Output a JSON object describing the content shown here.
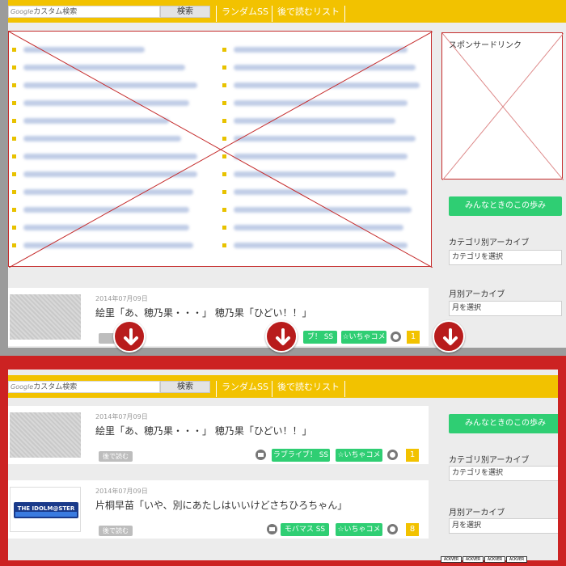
{
  "header": {
    "search_logo": "Google",
    "search_placeholder": "カスタム検索",
    "search_button": "検索",
    "nav": [
      "ランダムSS",
      "後で読むリスト"
    ]
  },
  "before": {
    "sponsor_label": "スポンサードリンク",
    "sidebar": {
      "button": "みんなときのこの歩み",
      "category_label": "カテゴリ別アーカイブ",
      "category_select": "カテゴリを選択",
      "month_label": "月別アーカイブ",
      "month_select": "月を選択"
    },
    "post": {
      "date": "2014年07月09日",
      "title": "絵里「あ、穂乃果・・・」 穂乃果「ひどい！！」",
      "tag_partial": "ブ！ SS",
      "tag_source": "☆いちゃコメ",
      "comment_count": "1"
    }
  },
  "after": {
    "sidebar": {
      "button": "みんなときのこの歩み",
      "category_label": "カテゴリ別アーカイブ",
      "category_select": "カテゴリを選択",
      "month_label": "月別アーカイブ",
      "month_select": "月を選択"
    },
    "posts": [
      {
        "date": "2014年07月09日",
        "title": "絵里「あ、穂乃果・・・」 穂乃果「ひどい！！」",
        "later": "後で読む",
        "tag": "ラブライブ！ SS",
        "source": "☆いちゃコメ",
        "count": "1"
      },
      {
        "date": "2014年07月09日",
        "title": "片桐早苗「いや、別にあたしはいいけどさちひろちゃん」",
        "later": "後で読む",
        "tag": "モバマス SS",
        "source": "☆いちゃコメ",
        "count": "8",
        "thumb_logo": "THE IDOLM@STER"
      }
    ],
    "badges": [
      "ACKVER",
      "ACKVER",
      "ACKVER",
      "ACKVER"
    ]
  },
  "colors": {
    "accent_yellow": "#f2c200",
    "tag_green": "#2fce73",
    "frame_red": "#cc2222",
    "arrow_red": "#b81c1c"
  }
}
